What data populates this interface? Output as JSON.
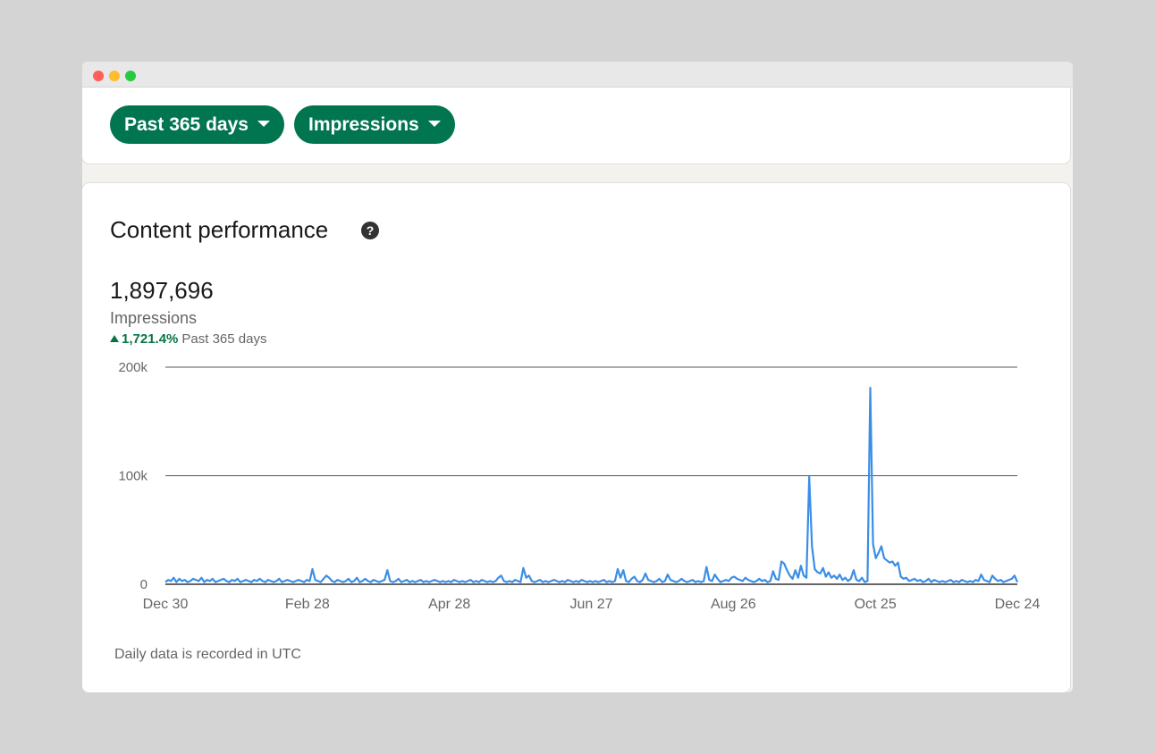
{
  "filters": {
    "range_label": "Past 365 days",
    "metric_label": "Impressions"
  },
  "panel": {
    "title": "Content performance",
    "help_glyph": "?",
    "total": "1,897,696",
    "total_label": "Impressions",
    "change": "1,721.4%",
    "change_period": "Past 365 days",
    "footnote": "Daily data is recorded in UTC"
  },
  "colors": {
    "accent": "#01754f",
    "positive": "#057642",
    "line": "#3a8ee6"
  },
  "chart_data": {
    "type": "line",
    "x_tick_labels": [
      "Dec 30",
      "Feb 28",
      "Apr 28",
      "Jun 27",
      "Aug 26",
      "Oct 25",
      "Dec 24"
    ],
    "y_tick_labels": [
      "0",
      "100k",
      "200k"
    ],
    "ylim": [
      0,
      200000
    ],
    "grid": true,
    "series": [
      {
        "values": [
          2000,
          4000,
          3000,
          6000,
          2000,
          5000,
          3000,
          4000,
          2000,
          3000,
          5000,
          4000,
          3000,
          6000,
          2000,
          4000,
          3000,
          5000,
          2000,
          3000,
          4000,
          5000,
          3000,
          2000,
          4000,
          3000,
          5000,
          2000,
          3000,
          4000,
          3000,
          2000,
          4000,
          3000,
          5000,
          3000,
          2000,
          4000,
          3000,
          2000,
          3000,
          5000,
          2000,
          3000,
          4000,
          3000,
          2000,
          3000,
          4000,
          3000,
          2000,
          4000,
          3000,
          14000,
          4000,
          3000,
          2000,
          5000,
          8000,
          6000,
          3000,
          2000,
          4000,
          3000,
          2000,
          3000,
          5000,
          2000,
          3000,
          6000,
          2000,
          3000,
          5000,
          3000,
          2000,
          4000,
          3000,
          2000,
          3000,
          4000,
          13000,
          3000,
          2000,
          3000,
          5000,
          2000,
          3000,
          4000,
          2000,
          3000,
          2000,
          3000,
          4000,
          2000,
          3000,
          2000,
          3000,
          4000,
          3000,
          2000,
          3000,
          2000,
          3000,
          2000,
          4000,
          3000,
          2000,
          3000,
          2000,
          3000,
          4000,
          2000,
          3000,
          2000,
          4000,
          3000,
          2000,
          3000,
          2000,
          3000,
          6000,
          8000,
          3000,
          2000,
          3000,
          2000,
          4000,
          3000,
          2000,
          15000,
          6000,
          8000,
          3000,
          2000,
          3000,
          4000,
          2000,
          3000,
          2000,
          3000,
          4000,
          3000,
          2000,
          3000,
          2000,
          4000,
          3000,
          2000,
          3000,
          2000,
          4000,
          3000,
          2000,
          3000,
          2000,
          3000,
          2000,
          3000,
          4000,
          2000,
          3000,
          2000,
          3000,
          14000,
          6000,
          13000,
          3000,
          2000,
          5000,
          7000,
          3000,
          2000,
          4000,
          10000,
          4000,
          3000,
          2000,
          3000,
          5000,
          2000,
          3000,
          9000,
          4000,
          3000,
          2000,
          3000,
          5000,
          3000,
          2000,
          3000,
          4000,
          2000,
          3000,
          2000,
          3000,
          16000,
          4000,
          3000,
          9000,
          5000,
          2000,
          3000,
          4000,
          3000,
          6000,
          7000,
          5000,
          4000,
          3000,
          6000,
          4000,
          3000,
          2000,
          3000,
          5000,
          3000,
          4000,
          2000,
          3000,
          12000,
          5000,
          4000,
          21000,
          19000,
          13000,
          8000,
          5000,
          13000,
          6000,
          17000,
          8000,
          6000,
          99000,
          35000,
          14000,
          11000,
          10000,
          15000,
          7000,
          11000,
          6000,
          8000,
          5000,
          9000,
          4000,
          6000,
          3000,
          5000,
          13000,
          4000,
          3000,
          6000,
          2000,
          3000,
          181000,
          37000,
          24000,
          29000,
          35000,
          24000,
          22000,
          20000,
          21000,
          17000,
          20000,
          7000,
          5000,
          6000,
          3000,
          4000,
          5000,
          3000,
          4000,
          2000,
          3000,
          5000,
          2000,
          4000,
          3000,
          2000,
          3000,
          2000,
          3000,
          4000,
          2000,
          3000,
          2000,
          4000,
          3000,
          2000,
          3000,
          2000,
          4000,
          3000,
          9000,
          4000,
          3000,
          2000,
          8000,
          5000,
          3000,
          4000,
          2000,
          3000,
          4000,
          5000,
          8000,
          2000
        ],
        "color": "#3a8ee6"
      }
    ]
  }
}
